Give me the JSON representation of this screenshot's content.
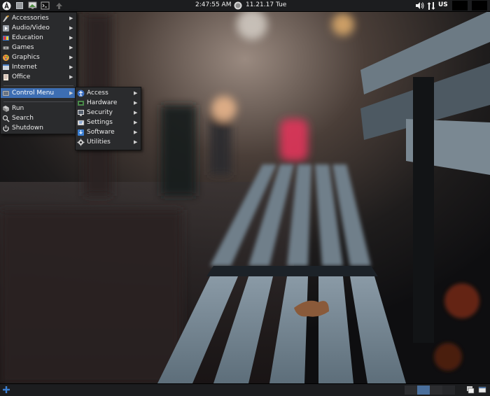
{
  "top_panel": {
    "clock_time": "2:47:55 AM",
    "clock_date": "11.21.17 Tue",
    "keyboard_layout": "US",
    "launcher_icons": [
      "app-menu-icon",
      "file-manager-icon",
      "display-icon",
      "terminal-icon",
      "update-arrow-icon"
    ],
    "tray_icons": [
      "volume-icon",
      "network-icon"
    ]
  },
  "main_menu": {
    "items": [
      {
        "label": "Accessories",
        "icon": "accessories-icon",
        "submenu": true
      },
      {
        "label": "Audio/Video",
        "icon": "audio-video-icon",
        "submenu": true
      },
      {
        "label": "Education",
        "icon": "education-icon",
        "submenu": true
      },
      {
        "label": "Games",
        "icon": "games-icon",
        "submenu": true
      },
      {
        "label": "Graphics",
        "icon": "graphics-icon",
        "submenu": true
      },
      {
        "label": "Internet",
        "icon": "internet-icon",
        "submenu": true
      },
      {
        "label": "Office",
        "icon": "office-icon",
        "submenu": true
      },
      {
        "label": "Control Menu",
        "icon": "control-menu-icon",
        "submenu": true,
        "active": true
      },
      {
        "label": "Run",
        "icon": "run-icon"
      },
      {
        "label": "Search",
        "icon": "search-icon"
      },
      {
        "label": "Shutdown",
        "icon": "shutdown-icon"
      }
    ]
  },
  "control_submenu": {
    "items": [
      {
        "label": "Access",
        "icon": "access-icon",
        "submenu": true
      },
      {
        "label": "Hardware",
        "icon": "hardware-icon",
        "submenu": true
      },
      {
        "label": "Security",
        "icon": "security-icon",
        "submenu": true
      },
      {
        "label": "Settings",
        "icon": "settings-icon",
        "submenu": true
      },
      {
        "label": "Software",
        "icon": "software-icon",
        "submenu": true
      },
      {
        "label": "Utilities",
        "icon": "utilities-icon",
        "submenu": true
      }
    ]
  },
  "bottom_panel": {
    "workspaces": 4,
    "active_workspace": 1,
    "icons": [
      "add-panel-icon",
      "show-desktop-icon",
      "window-list-icon"
    ]
  },
  "colors": {
    "panel": "#1c1d1f",
    "menu_bg": "#2a2b2d",
    "highlight": "#3d6eb3"
  }
}
